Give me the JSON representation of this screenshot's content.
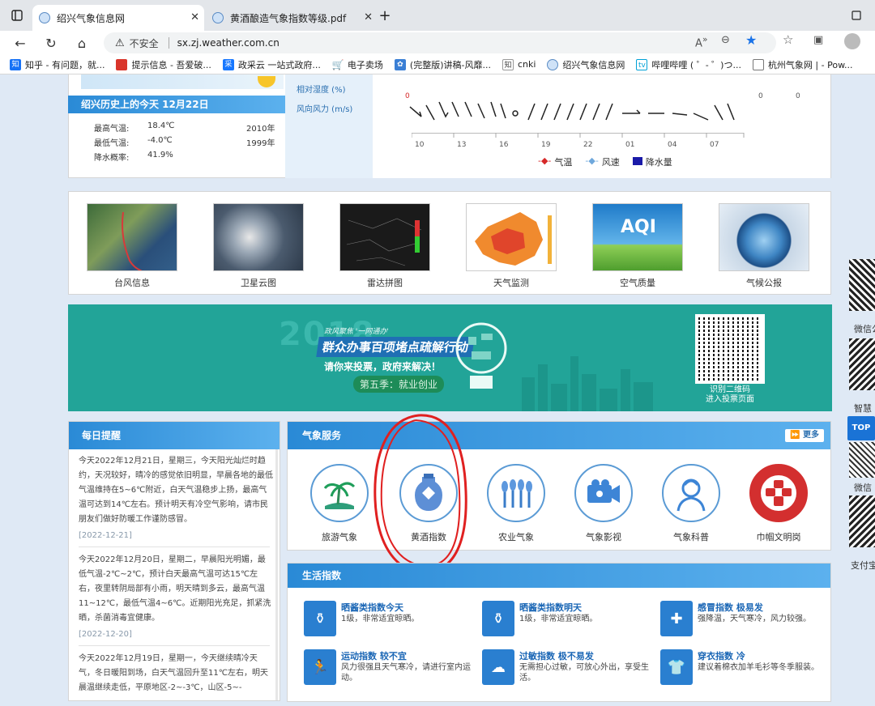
{
  "browser": {
    "tabs": [
      {
        "title": "绍兴气象信息网"
      },
      {
        "title": "黄酒酿造气象指数等级.pdf"
      }
    ],
    "security_label": "不安全",
    "url": "sx.zj.weather.com.cn",
    "bookmarks": [
      {
        "label": "知乎 - 有问题，就...",
        "icon": "zhihu-icon",
        "color": "#1772f6"
      },
      {
        "label": "提示信息 - 吾爱破...",
        "icon": "52pojie-icon",
        "color": "#d9352b"
      },
      {
        "label": "政采云 一站式政府...",
        "icon": "zcy-icon",
        "color": "#1677ff"
      },
      {
        "label": "电子卖场",
        "icon": "cart-icon",
        "color": "#555555"
      },
      {
        "label": "(完整版)讲稿-风靡...",
        "icon": "paw-icon",
        "color": "#3a7fd5"
      },
      {
        "label": "cnki",
        "icon": "cnki-icon",
        "color": "#444444"
      },
      {
        "label": "绍兴气象信息网",
        "icon": "globe-icon",
        "color": "#5a8bc4"
      },
      {
        "label": "哔哩哔哩 ( ゜- ゜)つ...",
        "icon": "bilibili-icon",
        "color": "#00a1d6"
      },
      {
        "label": "杭州气象网 | - Pow...",
        "icon": "page-icon",
        "color": "#777777"
      }
    ]
  },
  "weather_panel": {
    "history_title": "绍兴历史上的今天  12月22日",
    "history_rows": [
      {
        "label": "最高气温:",
        "value": "18.4℃",
        "year": "2010年"
      },
      {
        "label": "最低气温:",
        "value": "-4.0℃",
        "year": "1999年"
      },
      {
        "label": "降水概率:",
        "value": "41.9%",
        "year": ""
      }
    ],
    "humidity_label": "相对湿度 (%)",
    "wind_label": "风向风力 (m/s)",
    "chart_left_zero": "0",
    "chart_right_zero_1": "0",
    "chart_right_zero_2": "0",
    "hour_ticks": [
      "10",
      "13",
      "16",
      "19",
      "22",
      "01",
      "04",
      "07"
    ],
    "legend": [
      {
        "label": "气温",
        "color": "#d62828"
      },
      {
        "label": "风速",
        "color": "#6fa8dc"
      },
      {
        "label": "降水量",
        "color": "#1a1aa8"
      }
    ]
  },
  "quick_links": [
    {
      "label": "台风信息"
    },
    {
      "label": "卫星云图"
    },
    {
      "label": "雷达拼图"
    },
    {
      "label": "天气监测"
    },
    {
      "label": "空气质量",
      "badge": "AQI"
    },
    {
      "label": "气候公报"
    }
  ],
  "banner": {
    "year": "2018",
    "small_tag": "政风聚焦 '一网通办'",
    "headline": "群众办事百项堵点疏解行动",
    "subline": "请你来投票，政府来解决！",
    "pill": "第五季：就业创业",
    "qr_caption_1": "识别二维码",
    "qr_caption_2": "进入投票页面"
  },
  "daily_reminder": {
    "title": "每日提醒",
    "items": [
      {
        "text": "今天2022年12月21日，星期三，今天阳光灿烂时趋约，天况较好，晴冷的感觉依旧明显，早晨各地的最低气温维持在5~6℃附近，白天气温稳步上扬，最高气温可达到14℃左右。预计明天有冷空气影响，请市民朋友们做好防暖工作谨防感冒。",
        "date": "[2022-12-21]"
      },
      {
        "text": "今天2022年12月20日，星期二，早晨阳光明媚，最低气温-2℃~2℃，预计白天最高气温可达15℃左右，夜里转阴局部有小雨，明天晴到多云，最高气温11~12℃，最低气温4~6℃。近期阳光充足，抓紧洗晒，杀菌消毒宜健康。",
        "date": "[2022-12-20]"
      },
      {
        "text": "今天2022年12月19日，星期一，今天继续晴冷天气，冬日暖阳到场，白天气温回升至11℃左右，明天晨温继续走低，平原地区-2~-3℃，山区-5~-",
        "date": ""
      }
    ]
  },
  "weather_services": {
    "title": "气象服务",
    "more": "更多",
    "items": [
      {
        "label": "旅游气象",
        "icon": "palm-tree-icon"
      },
      {
        "label": "黄酒指数",
        "icon": "wine-jar-icon"
      },
      {
        "label": "农业气象",
        "icon": "wheat-icon"
      },
      {
        "label": "气象影视",
        "icon": "video-camera-icon"
      },
      {
        "label": "气象科普",
        "icon": "person-icon"
      },
      {
        "label": "巾帼文明岗",
        "icon": "emblem-icon"
      }
    ]
  },
  "life_index": {
    "title": "生活指数",
    "items": [
      {
        "title": "晒酱类指数今天",
        "desc": "1级，非常适宜晾晒。",
        "icon": "jar-icon"
      },
      {
        "title": "晒酱类指数明天",
        "desc": "1级，非常适宜晾晒。",
        "icon": "jar-icon"
      },
      {
        "title": "感冒指数  极易发",
        "desc": "强降温，天气寒冷，风力较强。",
        "icon": "medkit-icon"
      },
      {
        "title": "运动指数  较不宜",
        "desc": "风力很强且天气寒冷，请进行室内运动。",
        "icon": "runner-icon"
      },
      {
        "title": "过敏指数  极不易发",
        "desc": "无需担心过敏，可放心外出，享受生活。",
        "icon": "cloud-icon"
      },
      {
        "title": "穿衣指数  冷",
        "desc": "建议着棉衣加羊毛衫等冬季服装。",
        "icon": "shirt-icon"
      }
    ]
  },
  "side": {
    "top_button": "TOP",
    "labels": [
      "微信公",
      "智慧",
      "微信",
      "支付宝"
    ]
  }
}
